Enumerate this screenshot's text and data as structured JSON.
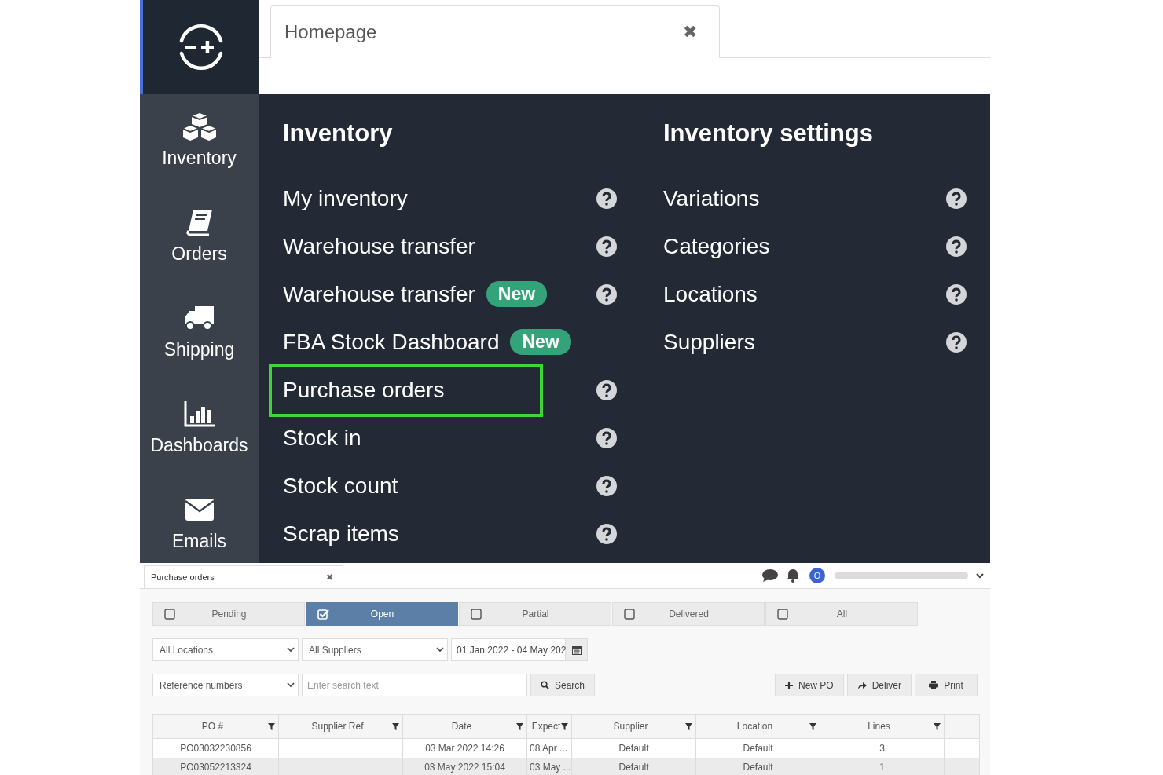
{
  "top_tab": {
    "title": "Homepage",
    "close": "✖"
  },
  "sidebar": {
    "items": [
      {
        "label": "Inventory"
      },
      {
        "label": "Orders"
      },
      {
        "label": "Shipping"
      },
      {
        "label": "Dashboards"
      },
      {
        "label": "Emails"
      }
    ]
  },
  "menu": {
    "columns": [
      {
        "heading": "Inventory",
        "items": [
          {
            "label": "My inventory",
            "help": true,
            "highlighted": false
          },
          {
            "label": "Warehouse transfer",
            "help": true,
            "highlighted": false
          },
          {
            "label": "Warehouse transfer",
            "badge": "New",
            "help": true,
            "highlighted": false
          },
          {
            "label": "FBA Stock Dashboard",
            "badge": "New",
            "help": false,
            "highlighted": false
          },
          {
            "label": "Purchase orders",
            "help": true,
            "highlighted": true
          },
          {
            "label": "Stock in",
            "help": true,
            "highlighted": false
          },
          {
            "label": "Stock count",
            "help": true,
            "highlighted": false
          },
          {
            "label": "Scrap items",
            "help": true,
            "highlighted": false
          }
        ]
      },
      {
        "heading": "Inventory settings",
        "items": [
          {
            "label": "Variations",
            "help": true,
            "highlighted": false
          },
          {
            "label": "Categories",
            "help": true,
            "highlighted": false
          },
          {
            "label": "Locations",
            "help": true,
            "highlighted": false
          },
          {
            "label": "Suppliers",
            "help": true,
            "highlighted": false
          }
        ]
      }
    ]
  },
  "page_tab": {
    "title": "Purchase orders",
    "close": "✖"
  },
  "user": {
    "avatar": "O"
  },
  "status_filters": [
    {
      "label": "Pending",
      "selected": false
    },
    {
      "label": "Open",
      "selected": true
    },
    {
      "label": "Partial",
      "selected": false
    },
    {
      "label": "Delivered",
      "selected": false
    },
    {
      "label": "All",
      "selected": false
    }
  ],
  "filters": {
    "location": "All Locations",
    "supplier": "All Suppliers",
    "date_range": "01 Jan 2022 - 04 May 202",
    "search_by": "Reference numbers",
    "search_placeholder": "Enter search text",
    "search_button": "Search"
  },
  "actions": [
    "New PO",
    "Deliver",
    "Print"
  ],
  "table": {
    "columns": [
      "PO #",
      "Supplier Ref",
      "Date",
      "Expect",
      "Supplier",
      "Location",
      "Lines"
    ],
    "rows": [
      [
        "PO03032230856",
        "",
        "03 Mar 2022 14:26",
        "08 Apr ...",
        "Default",
        "Default",
        "3"
      ],
      [
        "PO03052213324",
        "",
        "03 May 2022 15:04",
        "03 May ...",
        "Default",
        "Default",
        "1"
      ]
    ]
  }
}
